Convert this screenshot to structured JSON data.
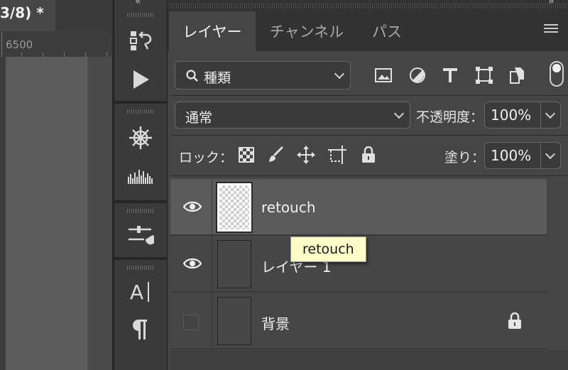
{
  "document": {
    "tab_title": "3/8) *",
    "ruler_mark": "6500"
  },
  "tabs": [
    {
      "label": "レイヤー",
      "active": true
    },
    {
      "label": "チャンネル",
      "active": false
    },
    {
      "label": "パス",
      "active": false
    }
  ],
  "filter": {
    "kind_label": "種類",
    "icons": [
      "image-filter-icon",
      "adjustment-filter-icon",
      "type-filter-icon",
      "shape-filter-icon",
      "smart-object-filter-icon",
      "filter-toggle-switch"
    ]
  },
  "blend": {
    "mode": "通常",
    "opacity_label": "不透明度：",
    "opacity_value": "100%"
  },
  "lock": {
    "label": "ロック：",
    "icons": [
      "lock-transparent-pixels-icon",
      "lock-image-pixels-icon",
      "lock-position-icon",
      "lock-artboard-icon",
      "lock-all-icon"
    ],
    "fill_label": "塗り：",
    "fill_value": "100%"
  },
  "layers": [
    {
      "name": "retouch",
      "visible": true,
      "selected": true,
      "locked": false
    },
    {
      "name": "レイヤー 1",
      "visible": true,
      "selected": false,
      "locked": false
    },
    {
      "name": "背景",
      "visible": false,
      "selected": false,
      "locked": true
    }
  ],
  "tooltip": "retouch",
  "colors": {
    "panel": "#454545",
    "selected_row": "#5b5b5b",
    "tooltip_bg": "#fefdc8"
  }
}
